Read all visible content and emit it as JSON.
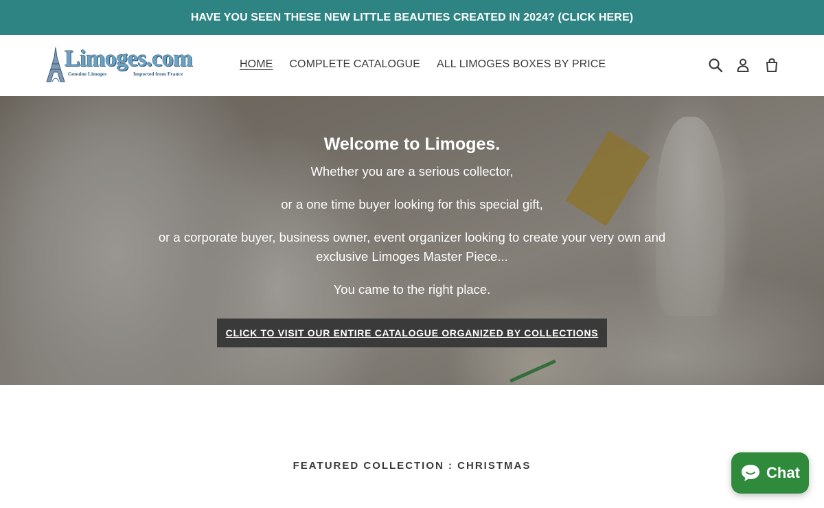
{
  "announcement": {
    "text": "HAVE YOU SEEN THESE NEW LITTLE BEAUTIES CREATED IN 2024? (CLICK HERE)",
    "bg_color": "#2e8383"
  },
  "header": {
    "logo": {
      "name": "Limoges.com",
      "tagline_left": "Genuine Limoges",
      "tagline_right": "Imported from France"
    },
    "nav": [
      {
        "label": "HOME",
        "active": true
      },
      {
        "label": "COMPLETE CATALOGUE",
        "active": false
      },
      {
        "label": "ALL LIMOGES BOXES BY PRICE",
        "active": false
      }
    ],
    "icons": [
      "search-icon",
      "account-icon",
      "cart-icon"
    ]
  },
  "hero": {
    "title": "Welcome to Limoges.",
    "lines": [
      "Whether you are a serious collector,",
      "or a one time buyer looking for this special gift,",
      "or a corporate buyer, business owner, event organizer looking to create your very own and exclusive Limoges Master Piece...",
      "You came to the right place."
    ],
    "cta_label": "CLICK TO VISIT OUR ENTIRE CATALOGUE ORGANIZED BY COLLECTIONS"
  },
  "featured": {
    "heading": "FEATURED COLLECTION : CHRISTMAS"
  },
  "chat": {
    "label": "Chat",
    "color": "#2f8a3c"
  }
}
